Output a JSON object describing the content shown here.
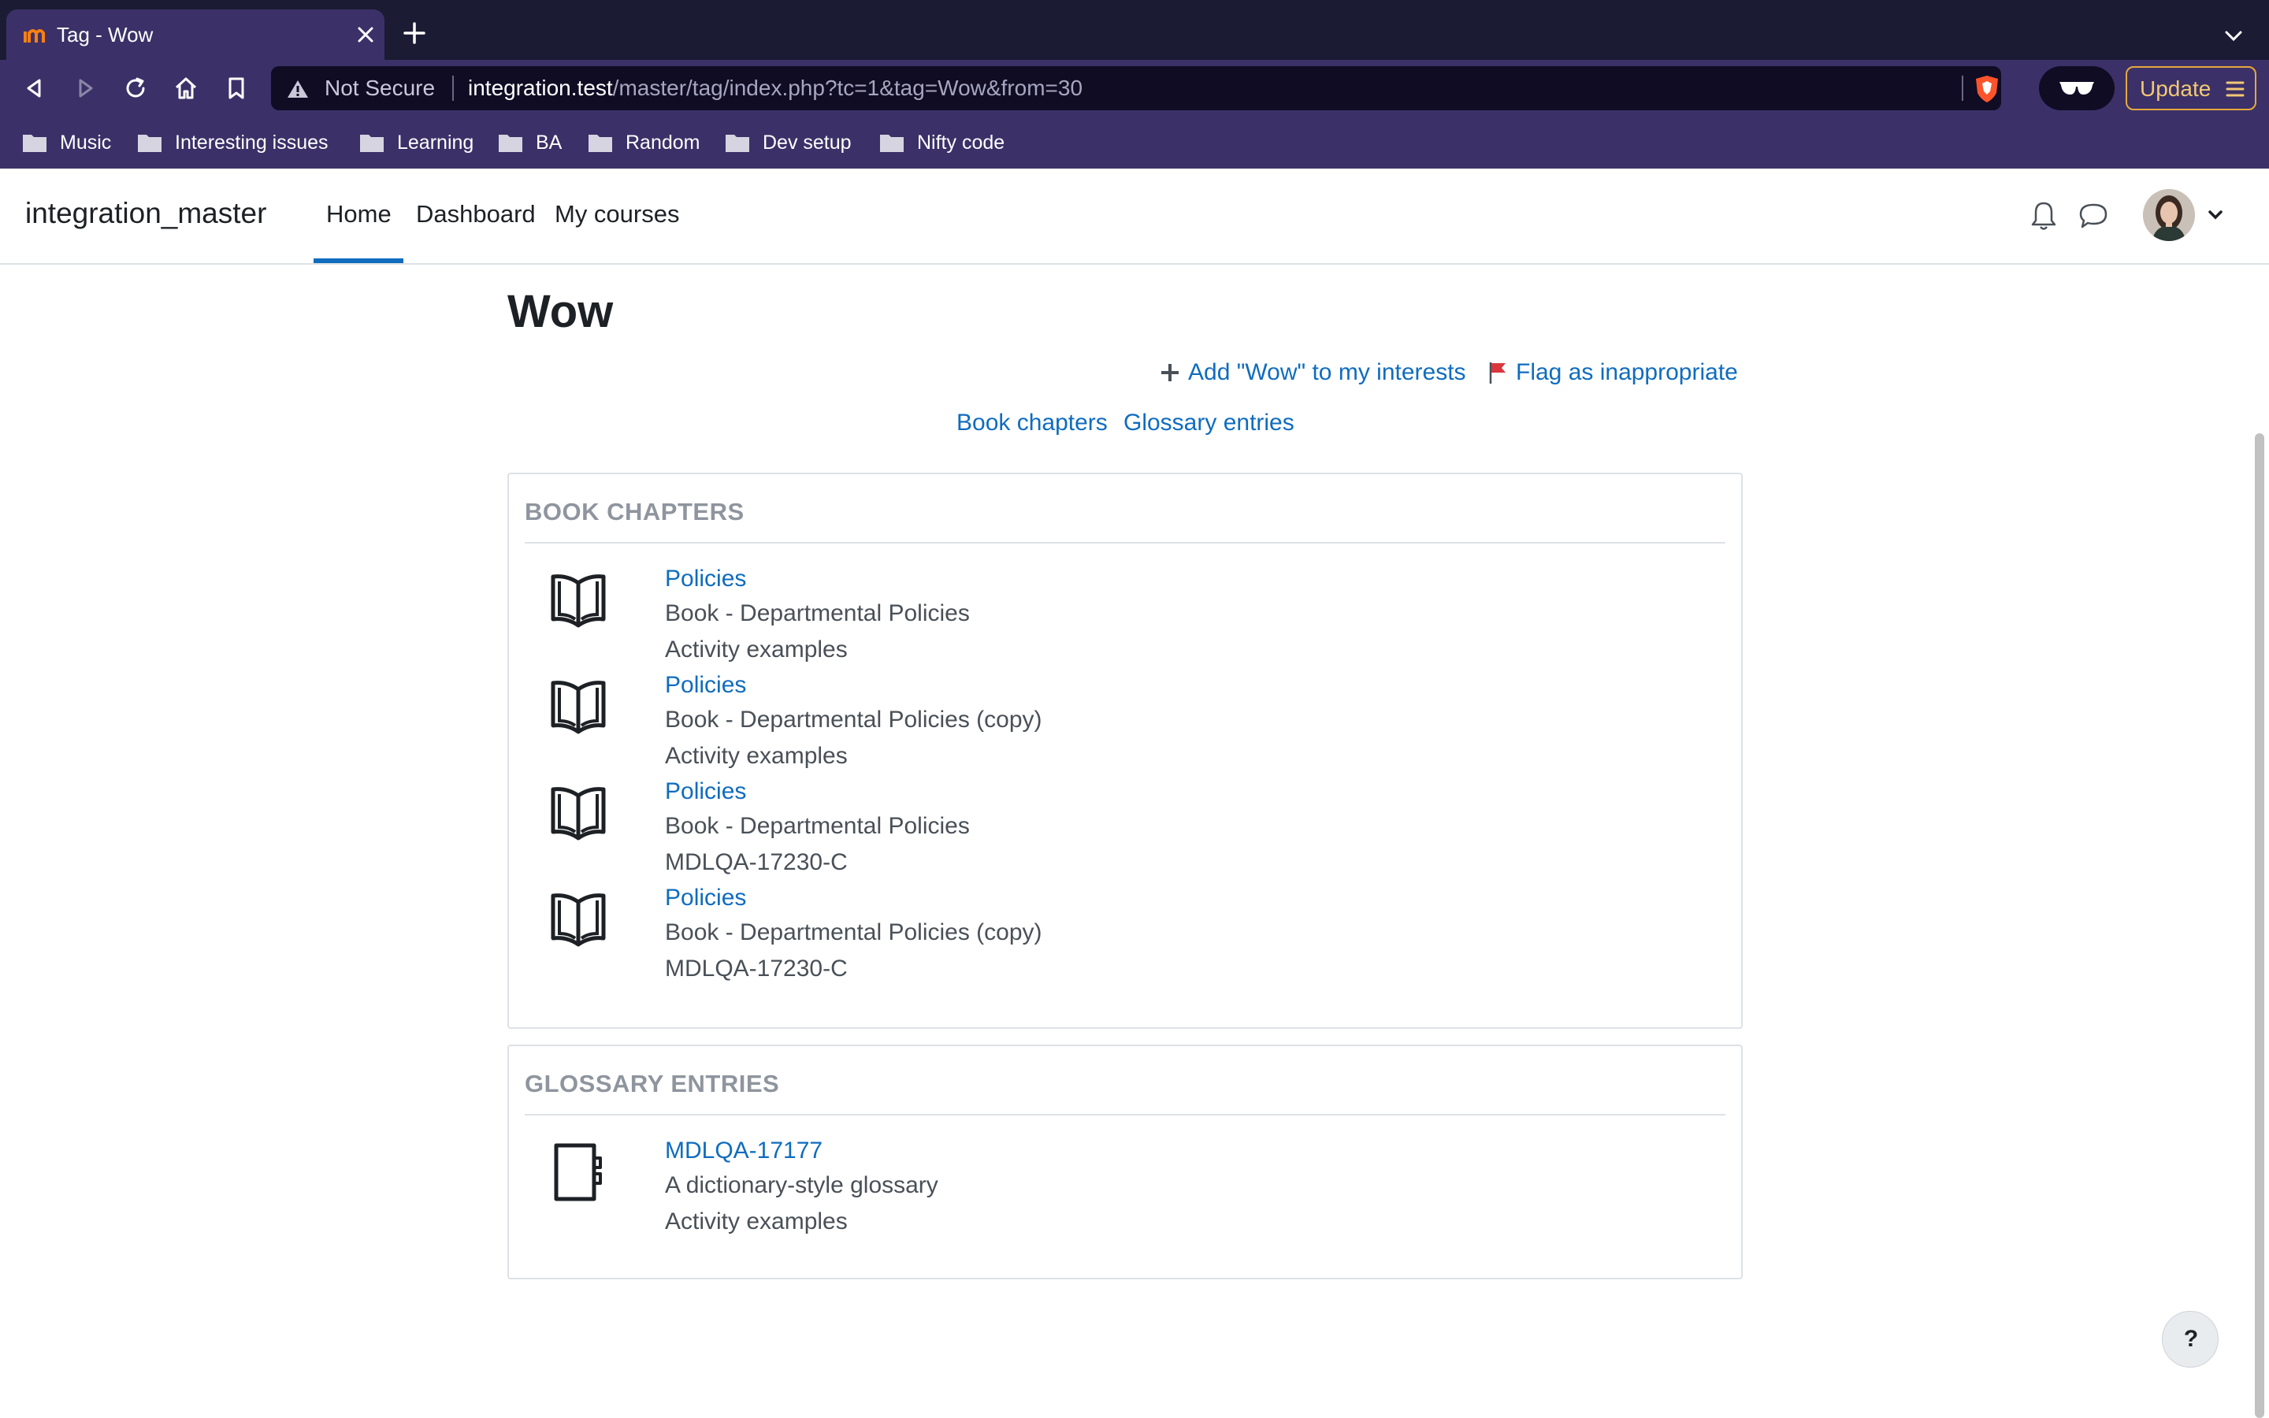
{
  "browser": {
    "tab_title": "Tag - Wow",
    "url_security": "Not Secure",
    "url_host": "integration.test",
    "url_path": "/master/tag/index.php?tc=1&tag=Wow&from=30",
    "update_label": "Update",
    "bookmarks": [
      "Music",
      "Interesting issues",
      "Learning",
      "BA",
      "Random",
      "Dev setup",
      "Nifty code"
    ]
  },
  "navbar": {
    "site_name": "integration_master",
    "links": [
      "Home",
      "Dashboard",
      "My courses"
    ],
    "active_link": "Home"
  },
  "page": {
    "title": "Wow",
    "add_interest": "Add \"Wow\" to my interests",
    "flag": "Flag as inappropriate",
    "tag_areas": [
      "Book chapters",
      "Glossary entries"
    ]
  },
  "book_chapters": {
    "header": "BOOK CHAPTERS",
    "items": [
      {
        "title": "Policies",
        "context": "Book - Departmental Policies",
        "course": "Activity examples"
      },
      {
        "title": "Policies",
        "context": "Book - Departmental Policies (copy)",
        "course": "Activity examples"
      },
      {
        "title": "Policies",
        "context": "Book - Departmental Policies",
        "course": "MDLQA-17230-C"
      },
      {
        "title": "Policies",
        "context": "Book - Departmental Policies (copy)",
        "course": "MDLQA-17230-C"
      }
    ]
  },
  "glossary_entries": {
    "header": "GLOSSARY ENTRIES",
    "items": [
      {
        "title": "MDLQA-17177",
        "context": "A dictionary-style glossary",
        "course": "Activity examples"
      }
    ]
  },
  "help": {
    "label": "?"
  },
  "colors": {
    "link": "#0f6cbf",
    "chrome": "#3b3168",
    "tabbar": "#1b1b33"
  }
}
